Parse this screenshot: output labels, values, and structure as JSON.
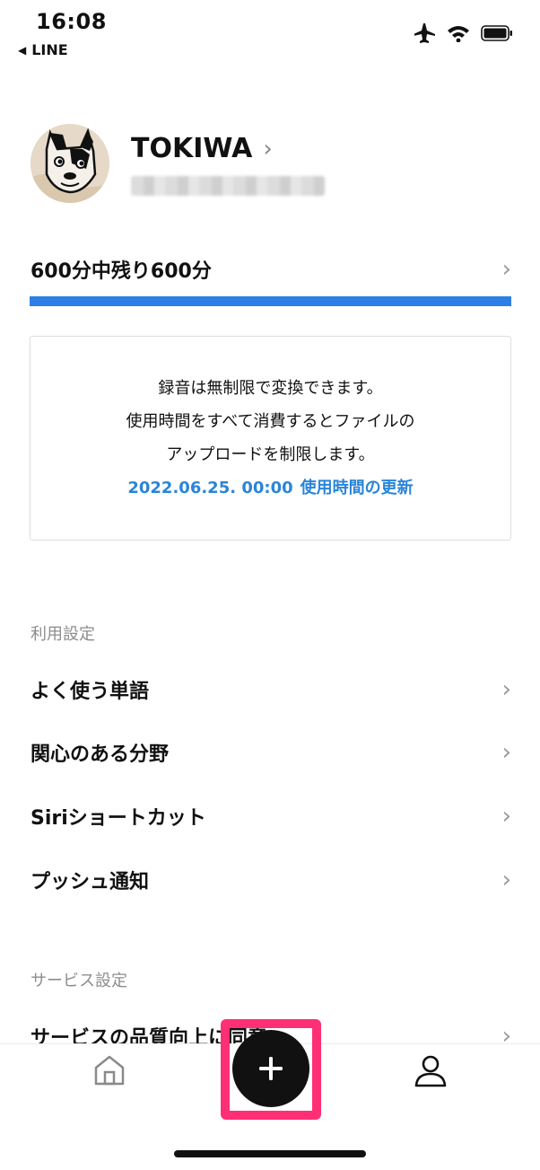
{
  "status_bar": {
    "time": "16:08",
    "back_label": "LINE",
    "back_arrow": "◀",
    "icons": [
      "airplane-icon",
      "wifi-icon",
      "battery-icon"
    ]
  },
  "profile": {
    "name": "TOKIWA",
    "chevron": "›"
  },
  "usage": {
    "text": "600分中残り600分",
    "chevron": "›",
    "progress_percent": 100,
    "bar_color": "#2c7fe6"
  },
  "info": {
    "line1": "録音は無制限で変換できます。",
    "line2": "使用時間をすべて消費するとファイルの",
    "line3": "アップロードを制限します。",
    "update_date": "2022.06.25. 00:00",
    "update_label": "使用時間の更新",
    "update_color": "#2a85d8"
  },
  "usage_settings": {
    "header": "利用設定",
    "items": [
      {
        "label": "よく使う単語",
        "chevron": "›"
      },
      {
        "label": "関心のある分野",
        "chevron": "›"
      },
      {
        "label": "Siriショートカット",
        "chevron": "›"
      },
      {
        "label": "プッシュ通知",
        "chevron": "›"
      }
    ]
  },
  "service_settings": {
    "header": "サービス設定",
    "items": [
      {
        "label": "サービスの品質向上に同意",
        "chevron": "›"
      }
    ]
  },
  "bottom_nav": {
    "home_icon": "home-icon",
    "add_icon": "plus-icon",
    "profile_icon": "person-icon",
    "highlight_color": "#ff2f76"
  }
}
